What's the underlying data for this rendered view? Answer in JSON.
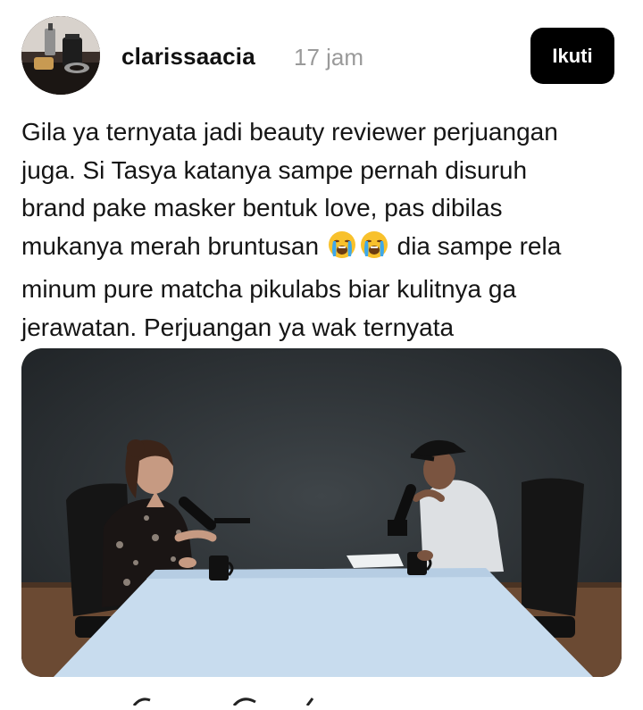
{
  "post": {
    "username": "clarissaacia",
    "timestamp": "17 jam",
    "follow_label": "Ikuti",
    "caption": {
      "line1": "Gila ya ternyata jadi beauty reviewer perjuangan",
      "line2": "juga. Si Tasya katanya sampe pernah disuruh",
      "line3": "brand pake masker bentuk love, pas dibilas",
      "line4_before": "mukanya merah bruntusan ",
      "line4_after": " dia sampe rela",
      "line5": "minum pure matcha pikulabs biar kulitnya ga",
      "line6": "jerawatan. Perjuangan ya wak ternyata"
    },
    "emoji": [
      "loudly-crying-face",
      "loudly-crying-face"
    ]
  },
  "colors": {
    "follow_button_bg": "#000000",
    "timestamp": "#9a9a9a",
    "text": "#151515"
  }
}
